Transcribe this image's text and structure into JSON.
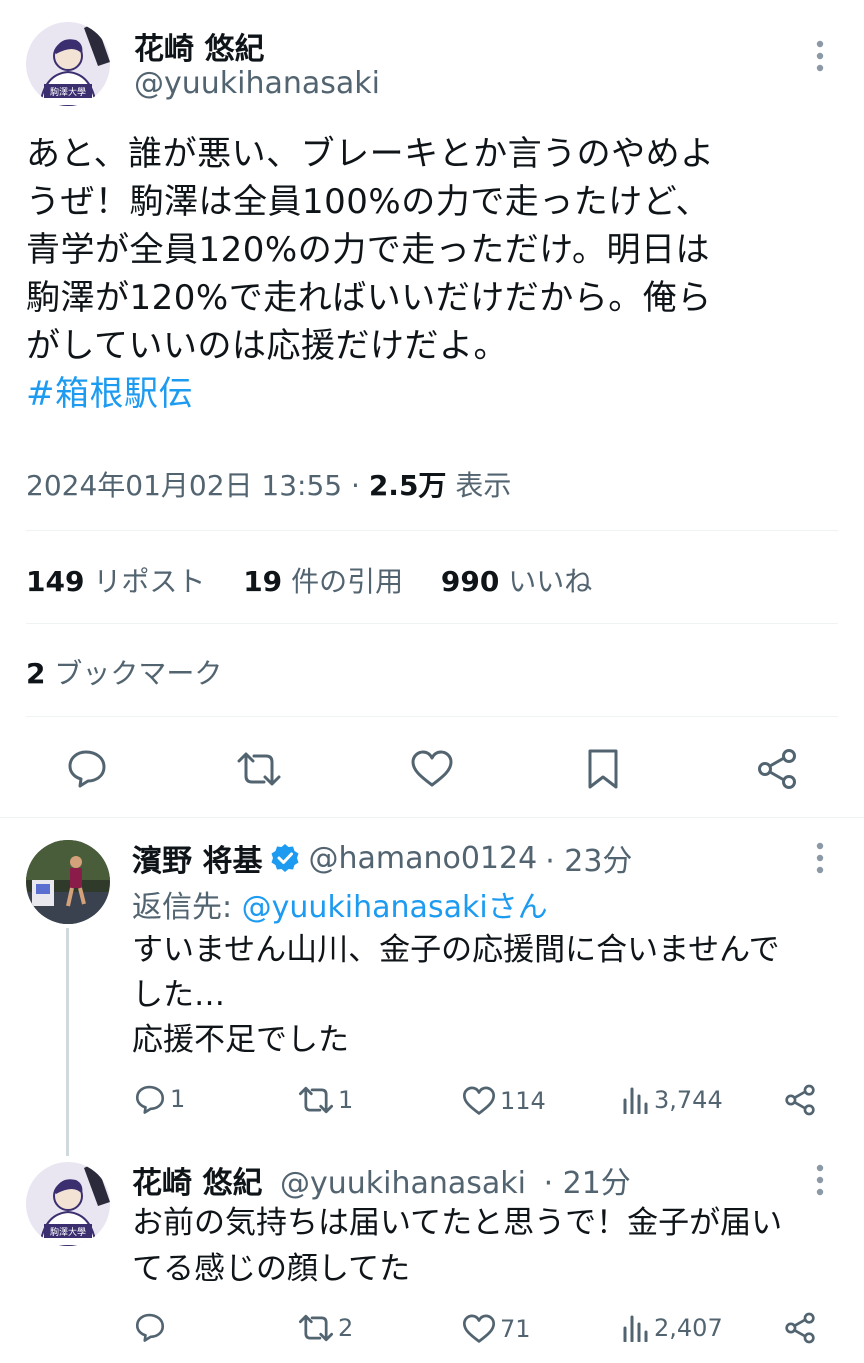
{
  "main_tweet": {
    "author_name": "花崎 悠紀",
    "author_handle": "@yuukihanasaki",
    "avatar_caption": "駒澤大學",
    "text_lines": [
      "あと、誰が悪い、ブレーキとか言うのやめよ",
      "うぜ！駒澤は全員100%の力で走ったけど、",
      "青学が全員120%の力で走っただけ。明日は",
      "駒澤が120%で走ればいいだけだから。俺ら",
      "がしていいのは応援だけだよ。"
    ],
    "hashtag": "#箱根駅伝",
    "timestamp": "2024年01月02日 13:55",
    "separator": "·",
    "views_count": "2.5万",
    "views_label": "表示",
    "stats": {
      "retweets": "149",
      "retweets_label": "リポスト",
      "quotes": "19",
      "quotes_label": "件の引用",
      "likes": "990",
      "likes_label": "いいね",
      "bookmarks": "2",
      "bookmarks_label": "ブックマーク"
    },
    "actions": [
      "reply-icon",
      "retweet-icon",
      "like-icon",
      "bookmark-icon",
      "share-icon"
    ]
  },
  "replies": [
    {
      "author_name": "濱野 将基",
      "verified": true,
      "author_handle": "@hamano0124",
      "time": "· 23分",
      "reply_to_label": "返信先:",
      "reply_to_handle": "@yuukihanasakiさん",
      "text_lines": [
        "すいません山川、金子の応援間に合いませんで",
        "した…",
        "応援不足でした"
      ],
      "replies": "1",
      "retweets": "1",
      "likes": "114",
      "views": "3,744"
    },
    {
      "author_name": "花崎 悠紀",
      "author_handle": "@yuukihanasaki",
      "time": "· 21分",
      "avatar_caption": "駒澤大學",
      "text_lines": [
        "お前の気持ちは届いてたと思うで！金子が届い",
        "てる感じの顔してた"
      ],
      "replies": "",
      "retweets": "2",
      "likes": "71",
      "views": "2,407"
    }
  ],
  "colors": {
    "text": "#0f1419",
    "muted": "#536471",
    "link": "#1d9bf0",
    "divider": "#eff3f4",
    "verified": "#1d9bf0"
  }
}
